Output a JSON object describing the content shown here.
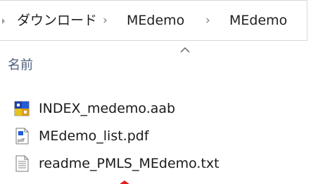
{
  "breadcrumb": {
    "items": [
      "ダウンロード",
      "MEdemo",
      "MEdemo"
    ]
  },
  "columns": {
    "name": "名前"
  },
  "files": [
    {
      "name": "INDEX_medemo.aab",
      "icon": "aab-file-icon"
    },
    {
      "name": "MEdemo_list.pdf",
      "icon": "pdf-file-icon"
    },
    {
      "name": "readme_PMLS_MEdemo.txt",
      "icon": "txt-file-icon"
    }
  ],
  "colors": {
    "header_text": "#4c607a",
    "marker": "#e02020"
  }
}
